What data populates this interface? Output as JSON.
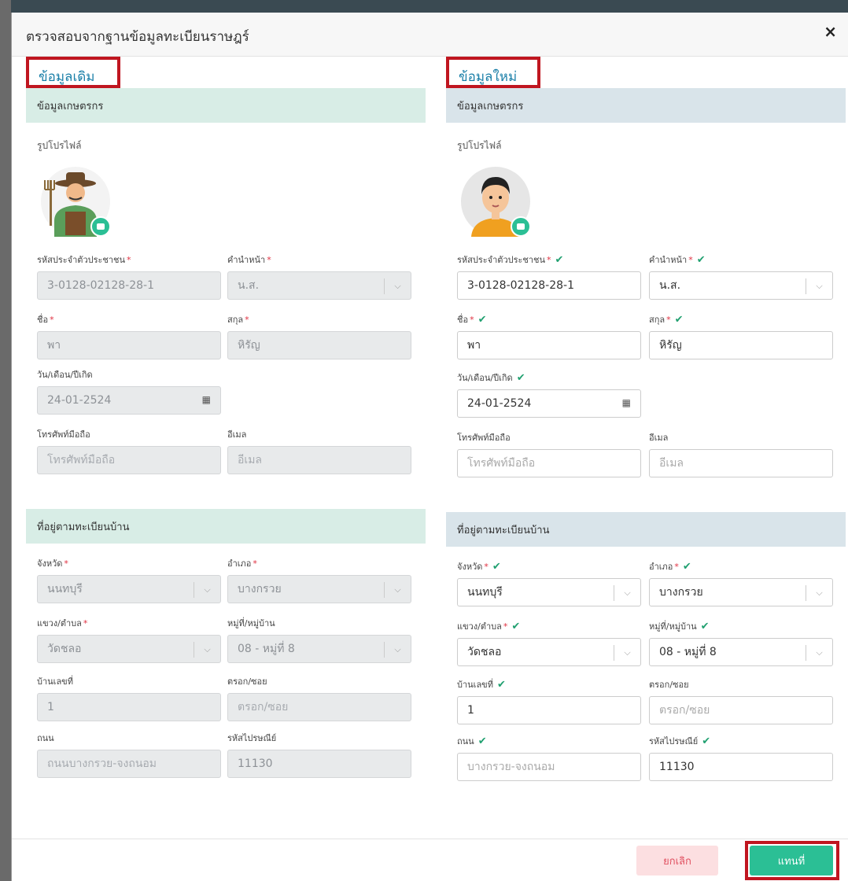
{
  "modal": {
    "title": "ตรวจสอบจากฐานข้อมูลทะเบียนราษฎร์",
    "close_label": "×"
  },
  "colors": {
    "accent": "#2bbf95",
    "title_blue": "#1a7fa8",
    "highlight": "#c01620",
    "required": "#e03040"
  },
  "left": {
    "title": "ข้อมูลเดิม",
    "farmer_section": "ข้อมูลเกษตรกร",
    "photo_label": "รูปโปรไฟล์",
    "fields": {
      "citizen_id": {
        "label": "รหัสประจำตัวประชาชน",
        "value": "3-0128-02128-28-1"
      },
      "prefix": {
        "label": "คำนำหน้า",
        "value": "น.ส."
      },
      "first_name": {
        "label": "ชื่อ",
        "value": "พา"
      },
      "last_name": {
        "label": "สกุล",
        "value": "หิรัญ"
      },
      "dob": {
        "label": "วัน/เดือน/ปีเกิด",
        "value": "24-01-2524"
      },
      "phone": {
        "label": "โทรศัพท์มือถือ",
        "placeholder": "โทรศัพท์มือถือ"
      },
      "email": {
        "label": "อีเมล",
        "placeholder": "อีเมล"
      }
    },
    "address_section": "ที่อยู่ตามทะเบียนบ้าน",
    "address": {
      "province": {
        "label": "จังหวัด",
        "value": "นนทบุรี"
      },
      "district": {
        "label": "อำเภอ",
        "value": "บางกรวย"
      },
      "subdistrict": {
        "label": "แขวง/ตำบล",
        "value": "วัดชลอ"
      },
      "village": {
        "label": "หมู่ที่/หมู่บ้าน",
        "value": "08 - หมู่ที่ 8"
      },
      "house_no": {
        "label": "บ้านเลขที่",
        "value": "1"
      },
      "alley": {
        "label": "ตรอก/ซอย",
        "placeholder": "ตรอก/ซอย"
      },
      "road": {
        "label": "ถนน",
        "placeholder": "ถนนบางกรวย-จงถนอม"
      },
      "postcode": {
        "label": "รหัสไปรษณีย์",
        "value": "11130"
      }
    }
  },
  "right": {
    "title": "ข้อมูลใหม่",
    "farmer_section": "ข้อมูลเกษตรกร",
    "photo_label": "รูปโปรไฟล์",
    "fields": {
      "citizen_id": {
        "label": "รหัสประจำตัวประชาชน",
        "value": "3-0128-02128-28-1"
      },
      "prefix": {
        "label": "คำนำหน้า",
        "value": "น.ส."
      },
      "first_name": {
        "label": "ชื่อ",
        "value": "พา"
      },
      "last_name": {
        "label": "สกุล",
        "value": "หิรัญ"
      },
      "dob": {
        "label": "วัน/เดือน/ปีเกิด",
        "value": "24-01-2524"
      },
      "phone": {
        "label": "โทรศัพท์มือถือ",
        "placeholder": "โทรศัพท์มือถือ"
      },
      "email": {
        "label": "อีเมล",
        "placeholder": "อีเมล"
      }
    },
    "address_section": "ที่อยู่ตามทะเบียนบ้าน",
    "address": {
      "province": {
        "label": "จังหวัด",
        "value": "นนทบุรี"
      },
      "district": {
        "label": "อำเภอ",
        "value": "บางกรวย"
      },
      "subdistrict": {
        "label": "แขวง/ตำบล",
        "value": "วัดชลอ"
      },
      "village": {
        "label": "หมู่ที่/หมู่บ้าน",
        "value": "08 - หมู่ที่ 8"
      },
      "house_no": {
        "label": "บ้านเลขที่",
        "value": "1"
      },
      "alley": {
        "label": "ตรอก/ซอย",
        "placeholder": "ตรอก/ซอย"
      },
      "road": {
        "label": "ถนน",
        "placeholder": "บางกรวย-จงถนอม"
      },
      "postcode": {
        "label": "รหัสไปรษณีย์",
        "value": "11130"
      }
    }
  },
  "footer": {
    "cancel_label": "ยกเลิก",
    "replace_label": "แทนที่"
  },
  "glyphs": {
    "required": "*",
    "check": "✔",
    "chevron": "⌵",
    "calendar": "▦"
  }
}
